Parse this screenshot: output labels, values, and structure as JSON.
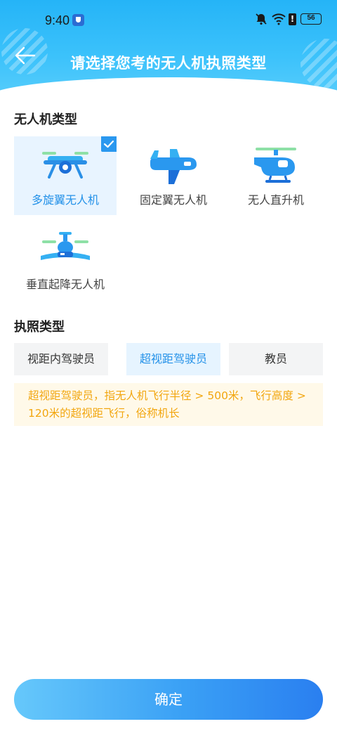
{
  "status_bar": {
    "time": "9:40",
    "battery": "56",
    "icons": [
      "shield-icon",
      "mute-bell-icon",
      "wifi-icon",
      "alert-icon",
      "battery-icon"
    ]
  },
  "header": {
    "title": "请选择您考的无人机执照类型",
    "back_icon": "arrow-left-icon",
    "bg_color": "#2ab6f8"
  },
  "drone_section": {
    "title": "无人机类型",
    "items": [
      {
        "label": "多旋翼无人机",
        "icon": "multirotor-drone-icon",
        "selected": true
      },
      {
        "label": "固定翼无人机",
        "icon": "fixed-wing-plane-icon",
        "selected": false
      },
      {
        "label": "无人直升机",
        "icon": "helicopter-icon",
        "selected": false
      },
      {
        "label": "垂直起降无人机",
        "icon": "vtol-drone-icon",
        "selected": false
      }
    ]
  },
  "license_section": {
    "title": "执照类型",
    "items": [
      {
        "label": "视距内驾驶员",
        "selected": false
      },
      {
        "label": "超视距驾驶员",
        "selected": true
      },
      {
        "label": "教员",
        "selected": false
      }
    ],
    "notice": "超视距驾驶员，指无人机飞行半径 > 500米，飞行高度 > 120米的超视距飞行，俗称机长"
  },
  "footer": {
    "confirm_label": "确定"
  },
  "colors": {
    "accent": "#2391e8",
    "notice_text": "#f2a60f",
    "notice_bg": "#fff9e9"
  }
}
